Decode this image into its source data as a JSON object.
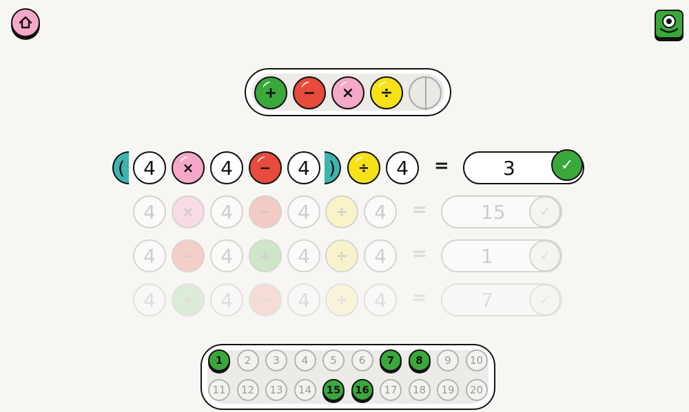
{
  "nav": {
    "home_icon": "home-icon",
    "monster_icon": "one-eyed-monster-icon"
  },
  "operators": [
    {
      "name": "plus",
      "symbol": "+",
      "color": "#3aa83a"
    },
    {
      "name": "minus",
      "symbol": "−",
      "color": "#e64b3c"
    },
    {
      "name": "times",
      "symbol": "×",
      "color": "#f5a8c8"
    },
    {
      "name": "divide",
      "symbol": "÷",
      "color": "#f7e21a"
    },
    {
      "name": "parentheses",
      "symbol": "",
      "color": "#e9e8e5"
    }
  ],
  "equations": [
    {
      "open_paren": "(",
      "n1": "4",
      "op1": "×",
      "n2": "4",
      "op2": "−",
      "n3": "4",
      "close_paren": ")",
      "op3": "÷",
      "n4": "4",
      "equals": "=",
      "answer": "3",
      "check": "✓",
      "state": "active"
    },
    {
      "n1": "4",
      "op1": "×",
      "n2": "4",
      "op2": "−",
      "n3": "4",
      "op3": "÷",
      "n4": "4",
      "equals": "=",
      "answer": "15",
      "check": "✓",
      "state": "faded"
    },
    {
      "n1": "4",
      "op1": "−",
      "n2": "4",
      "op2": "+",
      "n3": "4",
      "op3": "÷",
      "n4": "4",
      "equals": "=",
      "answer": "1",
      "check": "✓",
      "state": "faded"
    },
    {
      "n1": "4",
      "op1": "+",
      "n2": "4",
      "op2": "−",
      "n3": "4",
      "op3": "÷",
      "n4": "4",
      "equals": "=",
      "answer": "7",
      "check": "✓",
      "state": "faded"
    }
  ],
  "levels": {
    "row1": [
      "1",
      "2",
      "3",
      "4",
      "5",
      "6",
      "7",
      "8",
      "9",
      "10"
    ],
    "row2": [
      "11",
      "12",
      "13",
      "14",
      "15",
      "16",
      "17",
      "18",
      "19",
      "20"
    ],
    "completed": [
      "1",
      "7",
      "8",
      "15",
      "16"
    ]
  }
}
